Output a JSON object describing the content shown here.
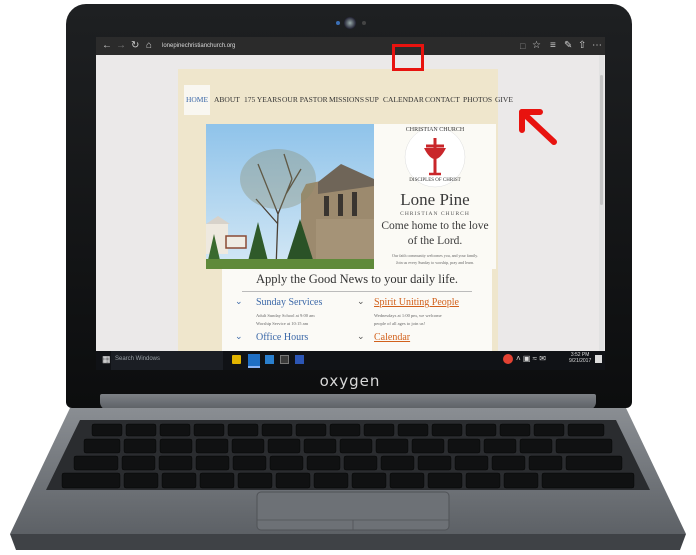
{
  "laptop": {
    "brand": "oxygen"
  },
  "browser": {
    "url": "lonepinechristianchurch.org",
    "nav_icons": [
      "back-arrow-icon",
      "forward-arrow-icon",
      "refresh-icon",
      "home-icon"
    ],
    "toolbar_icons": [
      "reading-view-icon",
      "favorite-star-icon",
      "hub-icon",
      "web-note-icon",
      "share-icon",
      "more-icon"
    ]
  },
  "site": {
    "nav": [
      "HOME",
      "ABOUT",
      "175 YEARS",
      "OUR PASTOR",
      "MISSIONS",
      "SUP",
      "CALENDAR",
      "CONTACT",
      "PHOTOS",
      "GIVE"
    ],
    "active_nav": "HOME",
    "logo": {
      "ring_top": "CHRISTIAN CHURCH",
      "ring_bottom": "DISCIPLES OF CHRIST"
    },
    "church_name": "Lone Pine",
    "church_subtitle": "CHRISTIAN CHURCH",
    "tagline_line1": "Come home to the love",
    "tagline_line2": "of the Lord.",
    "welcome_line1": "Our faith community welcomes you, and your family.",
    "welcome_line2": "Join us every Sunday to worship, pray and learn.",
    "section_heading": "Apply the Good News to your daily life.",
    "sections": [
      {
        "title": "Sunday Services",
        "line1": "Adult Sunday School at 9:00 am",
        "line2": "Worship Service at 10:15 am",
        "style": "blue"
      },
      {
        "title": "Spirit Uniting People",
        "line1": "Wednesdays at 1:00 pm, we welcome",
        "line2": "people of all ages to join us!",
        "style": "orange"
      },
      {
        "title": "Office Hours",
        "line1": "",
        "line2": "",
        "style": "blue"
      },
      {
        "title": "Calendar",
        "line1": "",
        "line2": "",
        "style": "orange"
      }
    ]
  },
  "taskbar": {
    "search_placeholder": "Search Windows",
    "time": "3:52 PM",
    "date": "9/21/2017"
  },
  "colors": {
    "annotation": "#e8130f",
    "link_blue": "#3b68a8",
    "link_orange": "#d2611c"
  }
}
